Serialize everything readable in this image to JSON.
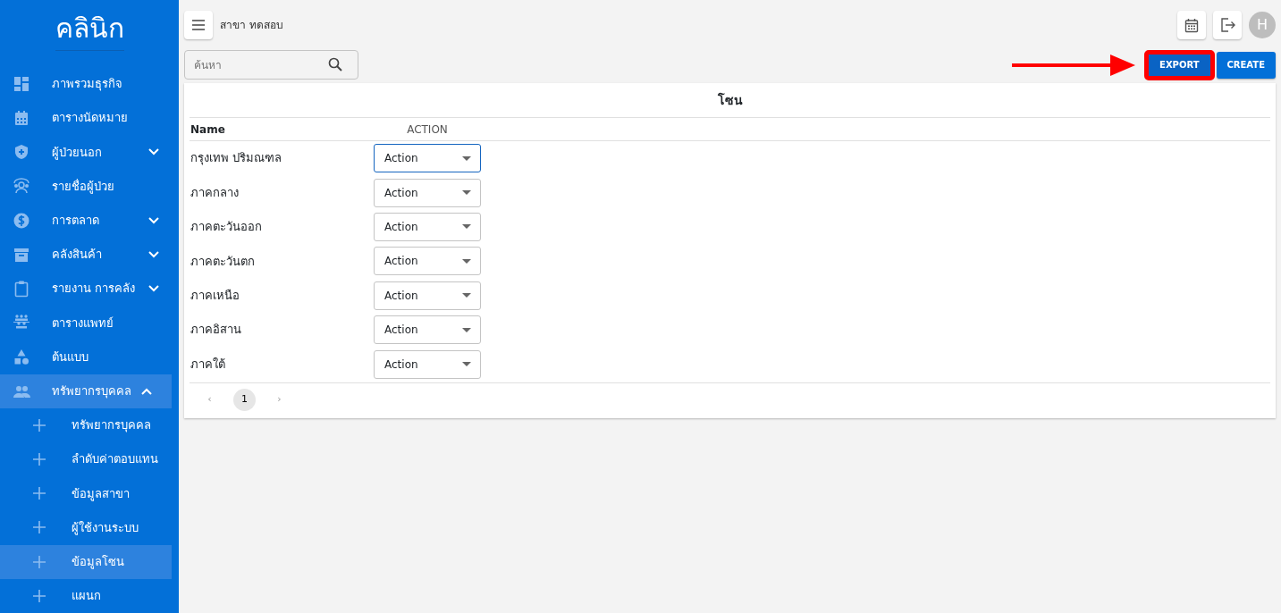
{
  "sidebar": {
    "logo": "คลินิก",
    "items": [
      {
        "label": "ภาพรวมธุรกิจ",
        "selected": false
      },
      {
        "label": "ตารางนัดหมาย",
        "selected": false
      },
      {
        "label": "ผู้ป่วยนอก",
        "selected": false,
        "expanded": false
      },
      {
        "label": "รายชื่อผู้ป่วย",
        "selected": false
      },
      {
        "label": "การตลาด",
        "selected": false,
        "expanded": false
      },
      {
        "label": "คลังสินค้า",
        "selected": false,
        "expanded": false
      },
      {
        "label": "รายงาน การคลัง",
        "selected": false,
        "expanded": false
      },
      {
        "label": "ตารางแพทย์",
        "selected": false
      },
      {
        "label": "ต้นแบบ",
        "selected": false
      },
      {
        "label": "ทรัพยากรบุคคล",
        "selected": false,
        "expanded": true,
        "children": [
          {
            "label": "ทรัพยากรบุคคล",
            "selected": false
          },
          {
            "label": "ลำดับค่าตอบแทน",
            "selected": false
          },
          {
            "label": "ข้อมูลสาขา",
            "selected": false
          },
          {
            "label": "ผู้ใช้งานระบบ",
            "selected": false
          },
          {
            "label": "ข้อมูลโซน",
            "selected": true
          },
          {
            "label": "แผนก",
            "selected": false
          }
        ]
      }
    ]
  },
  "topbar": {
    "branch": "สาขา ทดสอบ",
    "avatar": "H"
  },
  "search": {
    "placeholder": "ค้นหา"
  },
  "buttons": [
    {
      "label": "EXPORT",
      "highlighted": true
    },
    {
      "label": "CREATE",
      "highlighted": false
    }
  ],
  "table": {
    "title": "โซน",
    "columns": [
      "Name",
      "ACTION"
    ],
    "rows": [
      {
        "name": "กรุงเทพ ปริมณฑล",
        "action": "Action",
        "focused": true
      },
      {
        "name": "ภาคกลาง",
        "action": "Action",
        "focused": false
      },
      {
        "name": "ภาคตะวันออก",
        "action": "Action",
        "focused": false
      },
      {
        "name": "ภาคตะวันตก",
        "action": "Action",
        "focused": false
      },
      {
        "name": "ภาคเหนือ",
        "action": "Action",
        "focused": false
      },
      {
        "name": "ภาคอิสาน",
        "action": "Action",
        "focused": false
      },
      {
        "name": "ภาคใต้",
        "action": "Action",
        "focused": false
      }
    ]
  },
  "pagination": {
    "prev": "‹",
    "pages": [
      {
        "label": "1",
        "selected": true
      }
    ],
    "next": "›"
  }
}
